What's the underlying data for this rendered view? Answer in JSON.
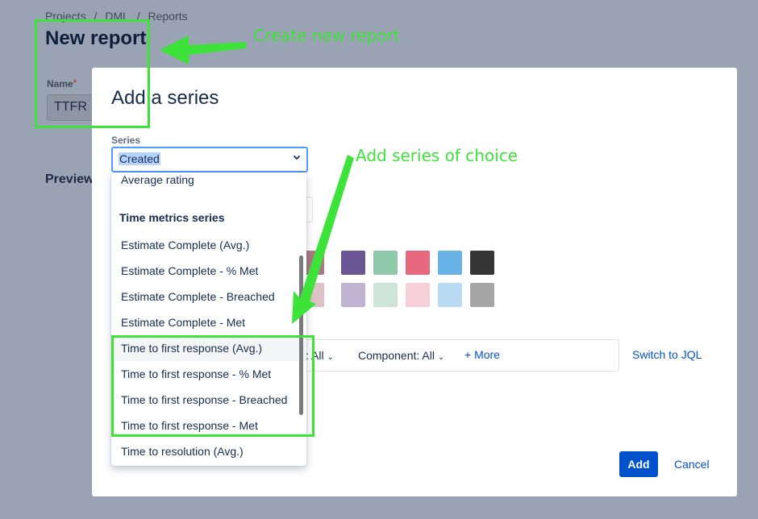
{
  "breadcrumb": [
    "Projects",
    "/",
    "DML",
    "/",
    "Reports"
  ],
  "page": {
    "title": "New report",
    "name_label": "Name",
    "name_required": "*",
    "name_value": "TTFR",
    "preview_label": "Preview"
  },
  "modal": {
    "title": "Add a series",
    "series_label": "Series",
    "series_value": "Created",
    "filter_fragment": "y: All",
    "filter_component": "Component: All",
    "more_label": "+ More",
    "switch_jql": "Switch to JQL",
    "add_label": "Add",
    "cancel_label": "Cancel"
  },
  "menu": {
    "partial_item": "Average rating",
    "group_label": "Time metrics series",
    "items": [
      "Estimate Complete (Avg.)",
      "Estimate Complete - % Met",
      "Estimate Complete - Breached",
      "Estimate Complete - Met",
      "Time to first response (Avg.)",
      "Time to first response - % Met",
      "Time to first response - Breached",
      "Time to first response - Met",
      "Time to resolution (Avg.)"
    ]
  },
  "swatches": {
    "row1": [
      "#a97a82",
      "#6b5594",
      "#8ec9aa",
      "#e8687e",
      "#67b3e6",
      "#363636"
    ],
    "row2": [
      "#dcc1c6",
      "#c0b2d1",
      "#cde5d8",
      "#f7cfd8",
      "#b9dbf2",
      "#a6a6a6"
    ]
  },
  "annotations": {
    "create_report": "Create new report",
    "add_series": "Add series of choice",
    "color": "#3ee33a"
  }
}
